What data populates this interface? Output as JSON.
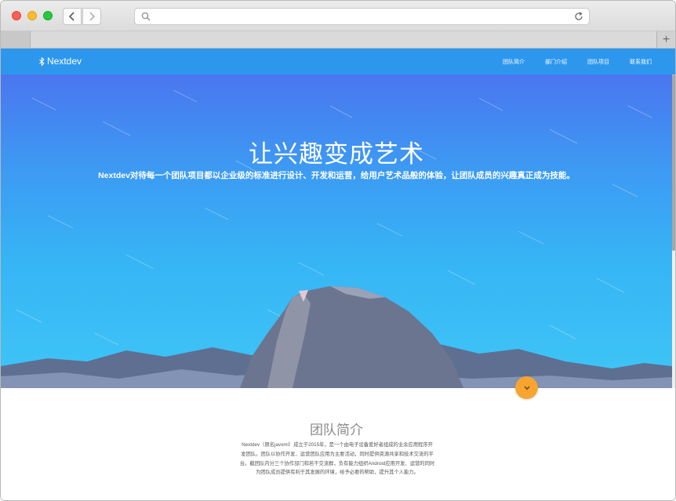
{
  "browser": {
    "url": "",
    "new_tab_label": "+"
  },
  "site": {
    "brand": "Nextdev",
    "nav": [
      {
        "label": "团队简介"
      },
      {
        "label": "部门介绍"
      },
      {
        "label": "团队项目"
      },
      {
        "label": "联系我们"
      }
    ],
    "hero": {
      "title": "让兴趣变成艺术",
      "subtitle": "Nextdev对待每一个团队项目都以企业级的标准进行设计、开发和运营，给用户艺术品般的体验，让团队成员的兴趣真正成为技能。"
    },
    "intro": {
      "title": "团队简介",
      "body": "Nextdev（原名javxml）成立于2015年，是一个由电子设备爱好者组成的业余应用程序开发团队。团队以协作开发、运营团队应用为主要活动，同时提供资源共享和技术交流的平台。截团队内分三个协作部门和若干交流群，负有能力组织Android应用开发、运营的同时为团队成员提供有利于其发展的环境，给予必要的帮助，提升其个人能力。"
    }
  },
  "colors": {
    "nav_bg": "#2d97ee",
    "hero_top": "#4a76ef",
    "hero_bottom": "#3fc6f6",
    "accent_button": "#f6a531"
  },
  "icons": {
    "back": "chevron-left-icon",
    "forward": "chevron-right-icon",
    "search": "search-icon",
    "reload": "reload-icon",
    "brand": "bluetooth-icon",
    "scroll_down": "chevron-down-icon"
  }
}
